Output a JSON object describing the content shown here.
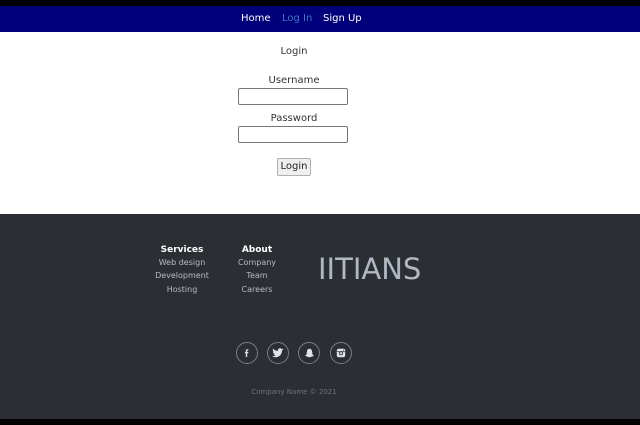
{
  "nav": {
    "items": [
      {
        "label": "Home",
        "active": false
      },
      {
        "label": "Log In",
        "active": true
      },
      {
        "label": "Sign Up",
        "active": false
      }
    ]
  },
  "login": {
    "heading": "Login",
    "username_label": "Username",
    "username_value": "",
    "password_label": "Password",
    "password_value": "",
    "submit_label": "Login"
  },
  "footer": {
    "services": {
      "title": "Services",
      "items": [
        "Web design",
        "Development",
        "Hosting"
      ]
    },
    "about": {
      "title": "About",
      "items": [
        "Company",
        "Team",
        "Careers"
      ]
    },
    "brand": "IITIANS",
    "social": [
      "facebook-icon",
      "twitter-icon",
      "snapchat-icon",
      "instagram-icon"
    ],
    "copyright": "Company Name © 2021"
  },
  "colors": {
    "nav_bg": "#00007a",
    "nav_active": "#3a79c4",
    "footer_bg": "#2b2e33"
  }
}
